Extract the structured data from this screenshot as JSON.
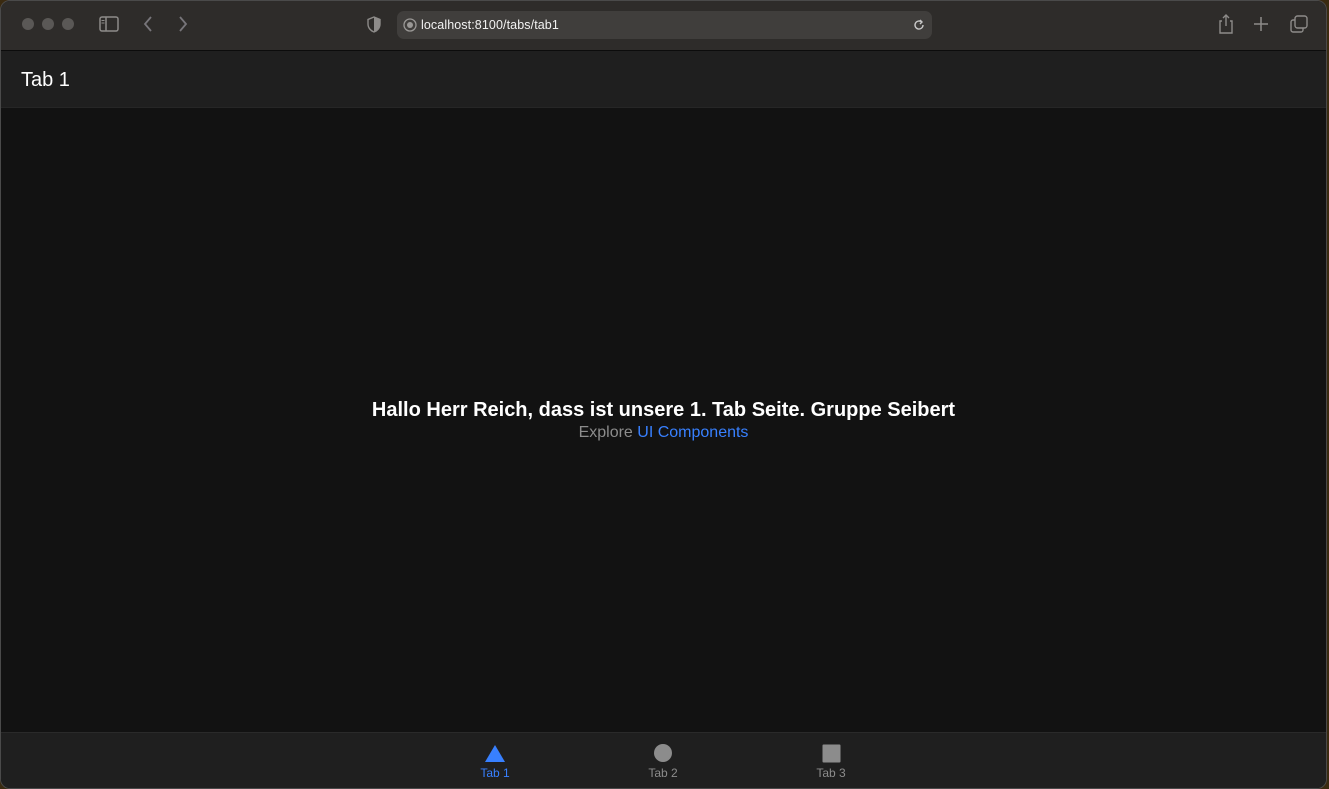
{
  "browser": {
    "url": "localhost:8100/tabs/tab1"
  },
  "app": {
    "header_title": "Tab 1",
    "headline": "Hallo Herr Reich, dass ist unsere 1. Tab Seite. Gruppe Seibert",
    "explore_prefix": "Explore",
    "explore_link": "UI Components",
    "accent_color": "#3880ff"
  },
  "tabs": [
    {
      "label": "Tab 1",
      "icon": "triangle-icon",
      "selected": true
    },
    {
      "label": "Tab 2",
      "icon": "ellipse-icon",
      "selected": false
    },
    {
      "label": "Tab 3",
      "icon": "square-icon",
      "selected": false
    }
  ]
}
